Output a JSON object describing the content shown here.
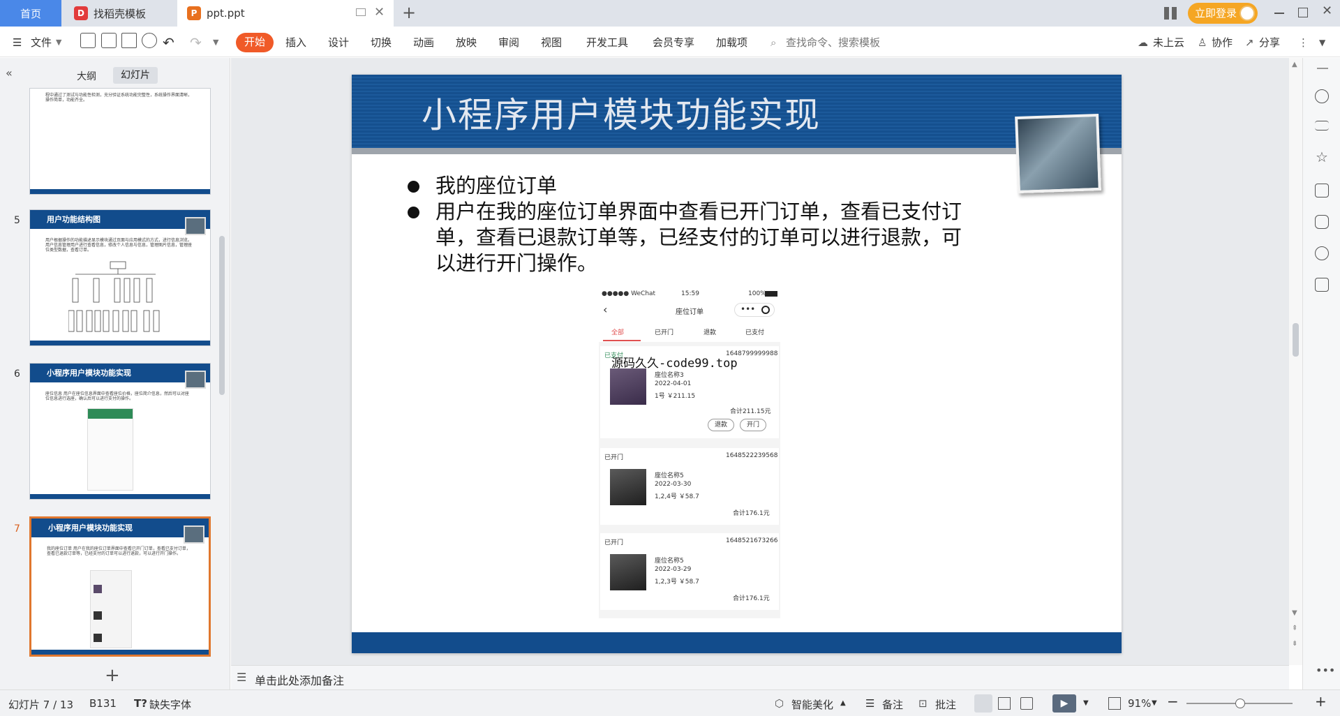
{
  "tabs": {
    "home": "首页",
    "t1": "找稻壳模板",
    "t2": "ppt.ppt",
    "add": "+"
  },
  "window_controls": {
    "login": "立即登录"
  },
  "ribbon": {
    "file": "文件",
    "items": [
      "开始",
      "插入",
      "设计",
      "切换",
      "动画",
      "放映",
      "审阅",
      "视图",
      "开发工具",
      "会员专享",
      "加载项"
    ],
    "search_placeholder": "查找命令、搜索模板",
    "cloud": "未上云",
    "collab": "协作",
    "share": "分享"
  },
  "left_panel": {
    "tab_outline": "大纲",
    "tab_slides": "幻灯片",
    "slides": [
      {
        "num": "5",
        "title": "用户功能结构图",
        "text": "用户根据操作的功能描述显示模块通过页面与应用模式的方式，进行信息浏览。用户信息管理用户进行查看信息，修改个人信息与信息，管理图片信息，管理座位类型数据，查看订单。"
      },
      {
        "num": "6",
        "title": "小程序用户模块功能实现",
        "text": "座位信息 用户在座位信息界面中查看座位价格，座位简介信息，然后可以对座位信息进行选座，确认后可以进行支付的操作。"
      },
      {
        "num": "7",
        "title": "小程序用户模块功能实现",
        "text": "我的座位订单 用户在我的座位订单界面中查看已开门订单，查看已支付订单，查看已退款订单等，已经支付的订单可以进行退款，可以进行开门操作。"
      }
    ],
    "top_partial_text": "程中通过了测试与功能性检测，充分验证系统功能完整性，系统操作界面清晰，操作简单，功能齐全。"
  },
  "slide": {
    "title": "小程序用户模块功能实现",
    "bullet1": "我的座位订单",
    "bullet2_l1": "用户在我的座位订单界面中查看已开门订单，查看已支付订",
    "bullet2_l2": "单，查看已退款订单等，已经支付的订单可以进行退款，可",
    "bullet2_l3": "以进行开门操作。"
  },
  "phone": {
    "status_left": "●●●●● WeChat",
    "status_time": "15:59",
    "status_right": "100%",
    "nav_title": "座位订单",
    "tabs": [
      "全部",
      "已开门",
      "退款",
      "已支付"
    ],
    "watermark": "源码久久-code99.top",
    "orders": [
      {
        "status": "已支付",
        "id": "1648799999988",
        "name": "座位名称3",
        "date": "2022-04-01",
        "seat": "1号 ￥211.15",
        "total": "合计211.15元",
        "btn1": "退款",
        "btn2": "开门"
      },
      {
        "status": "已开门",
        "id": "1648522239568",
        "name": "座位名称5",
        "date": "2022-03-30",
        "seat": "1,2,4号 ￥58.7",
        "total": "合计176.1元"
      },
      {
        "status": "已开门",
        "id": "1648521673266",
        "name": "座位名称5",
        "date": "2022-03-29",
        "seat": "1,2,3号 ￥58.7",
        "total": "合计176.1元"
      }
    ]
  },
  "notes": {
    "placeholder": "单击此处添加备注"
  },
  "status": {
    "slide_pos": "幻灯片 7 / 13",
    "cell": "B131",
    "missing_font": "缺失字体",
    "beautify": "智能美化",
    "notes": "备注",
    "comment": "批注",
    "zoom": "91%"
  }
}
